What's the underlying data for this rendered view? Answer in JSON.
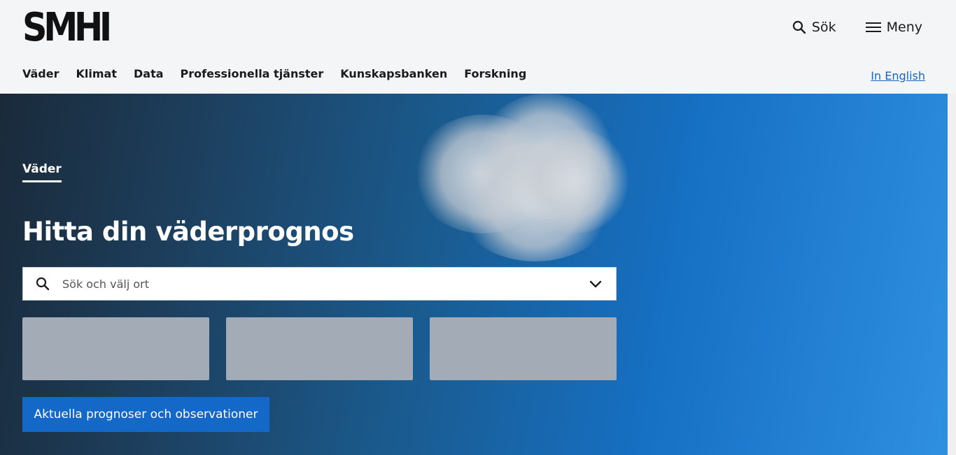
{
  "header": {
    "logo_text": "SMHI",
    "search_label": "Sök",
    "menu_label": "Meny",
    "language_link": "In English"
  },
  "nav": {
    "items": [
      "Väder",
      "Klimat",
      "Data",
      "Professionella tjänster",
      "Kunskapsbanken",
      "Forskning"
    ]
  },
  "hero": {
    "tab_label": "Väder",
    "title": "Hitta din väderprognos",
    "search": {
      "placeholder": "Sök och välj ort",
      "value": ""
    },
    "cards_count_label": "",
    "cta_label": "Aktuella prognoser och observationer"
  },
  "colors": {
    "accent": "#1468c8",
    "link": "#1565c0",
    "header_bg": "#f4f5f7",
    "placeholder_card": "#a3acb6"
  },
  "icons": {
    "search": "search-icon",
    "menu": "hamburger-icon",
    "dropdown": "chevron-down-icon"
  }
}
